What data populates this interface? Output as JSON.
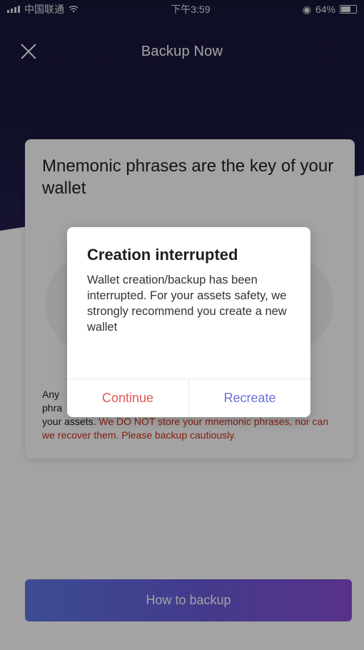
{
  "status_bar": {
    "carrier": "中国联通",
    "time": "下午3:59",
    "battery": "64%",
    "icons": [
      "signal-icon",
      "wifi-icon",
      "lock-rotation-icon",
      "battery-icon"
    ]
  },
  "nav": {
    "title": "Backup Now",
    "close_icon": "close-icon"
  },
  "card": {
    "title": "Mnemonic phrases are the key of your wallet",
    "body_visible_prefix_line1": "Any",
    "body_visible_prefix_line2": "phra",
    "body_line3_normal": "your assets.",
    "body_warning": "We DO NOT store your mnemonic phrases, nor can we recover them. Please backup cautiously."
  },
  "primary_button": {
    "label": "How to backup"
  },
  "dialog": {
    "title": "Creation interrupted",
    "message": "Wallet creation/backup has been interrupted. For your assets safety, we strongly recommend you create a new wallet",
    "continue_label": "Continue",
    "recreate_label": "Recreate"
  },
  "colors": {
    "header_bg": "#1c1b45",
    "warning_text": "#d0311c",
    "continue_text": "#e05a5a",
    "recreate_text": "#6b72d8",
    "button_gradient_start": "#5f78e6",
    "button_gradient_end": "#8a4fd8"
  }
}
